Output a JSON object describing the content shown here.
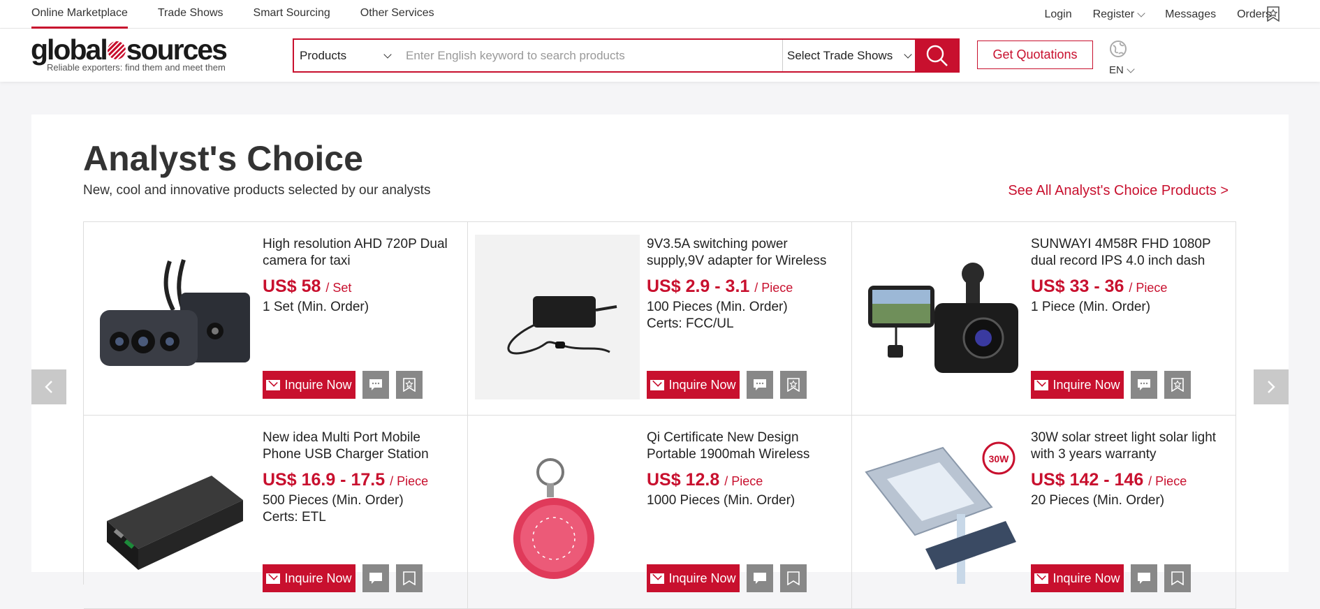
{
  "topnav": [
    "Online Marketplace",
    "Trade Shows",
    "Smart Sourcing",
    "Other Services"
  ],
  "toplinks": {
    "login": "Login",
    "register": "Register",
    "messages": "Messages",
    "orders": "Orders"
  },
  "logo": {
    "part1": "global",
    "part2": "sources",
    "tagline": "Reliable exporters: find them and meet them"
  },
  "search": {
    "category": "Products",
    "placeholder": "Enter English keyword to search products",
    "tradeshow": "Select Trade Shows"
  },
  "quote_button": "Get Quotations",
  "language": "EN",
  "section": {
    "title": "Analyst's Choice",
    "subtitle": "New, cool and innovative products selected by our analysts",
    "see_all": "See All Analyst's Choice Products >"
  },
  "inquire_label": "Inquire Now",
  "products": [
    {
      "title": "High resolution AHD 720P Dual camera for taxi",
      "price": "US$ 58",
      "unit": "/ Set",
      "moq": "1 Set (Min. Order)",
      "certs": "",
      "icon": "dual-camera-image"
    },
    {
      "title": "9V3.5A switching power supply,9V adapter for Wireless",
      "price": "US$ 2.9 - 3.1",
      "unit": "/ Piece",
      "moq": "100 Pieces (Min. Order)",
      "certs": "Certs: FCC/UL",
      "icon": "power-adapter-image"
    },
    {
      "title": "SUNWAYI 4M58R FHD 1080P dual record IPS 4.0 inch dash",
      "price": "US$ 33 - 36",
      "unit": "/ Piece",
      "moq": "1 Piece (Min. Order)",
      "certs": "",
      "icon": "dash-cam-image"
    },
    {
      "title": "New idea Multi Port Mobile Phone USB Charger Station",
      "price": "US$ 16.9 - 17.5",
      "unit": "/ Piece",
      "moq": "500 Pieces (Min. Order)",
      "certs": "Certs: ETL",
      "icon": "charger-station-image"
    },
    {
      "title": "Qi Certificate New Design Portable 1900mah Wireless",
      "price": "US$ 12.8",
      "unit": "/ Piece",
      "moq": "1000 Pieces (Min. Order)",
      "certs": "",
      "icon": "wireless-charger-keychain-image"
    },
    {
      "title": "30W solar street light solar light with 3 years warranty",
      "price": "US$ 142 - 146",
      "unit": "/ Piece",
      "moq": "20 Pieces (Min. Order)",
      "certs": "",
      "icon": "solar-street-light-image",
      "badge": "30W"
    }
  ],
  "colors": {
    "accent": "#c8102e",
    "button_gray": "#888888"
  }
}
